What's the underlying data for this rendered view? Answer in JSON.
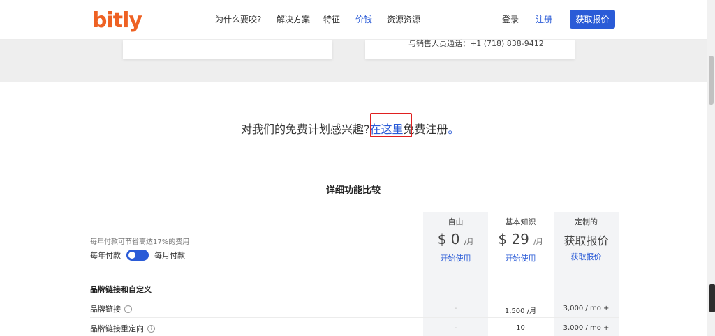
{
  "header": {
    "logo": "bitly",
    "nav": [
      {
        "label": "为什么要咬?",
        "active": false
      },
      {
        "label": "解决方案",
        "active": false
      },
      {
        "label": "特征",
        "active": false
      },
      {
        "label": "价钱",
        "active": true
      },
      {
        "label": "资源资源",
        "active": false
      }
    ],
    "login": "登录",
    "signup": "注册",
    "quote_button": "获取报价"
  },
  "sales_contact": "与销售人员通话：+1 (718) 838-9412",
  "free_plan": {
    "prefix": "对我们的免费计划感兴趣?",
    "link": "在这里",
    "suffix": "免费注册",
    "dot": "。"
  },
  "comparison": {
    "title": "详细功能比较",
    "save_note": "每年付款可节省高达17%的费用",
    "toggle_annual": "每年付款",
    "toggle_monthly": "每月付款",
    "plans": [
      {
        "name": "自由",
        "price": "$ 0",
        "unit": "/月",
        "cta": "开始使用"
      },
      {
        "name": "基本知识",
        "price": "$ 29",
        "unit": "/月",
        "cta": "开始使用"
      },
      {
        "name": "定制的",
        "price": "获取报价",
        "unit": "",
        "cta": "获取报价"
      }
    ],
    "group_title": "品牌链接和自定义",
    "rows": [
      {
        "label": "品牌链接",
        "free": "-",
        "basic": "1,500 /月",
        "custom": "3,000 / mo +"
      },
      {
        "label": "品牌链接重定向",
        "free": "-",
        "basic": "10",
        "custom": "3,000 / mo +"
      }
    ]
  },
  "colors": {
    "accent": "#2a5bd7",
    "brand": "#ee6123",
    "highlight": "#e02020"
  }
}
